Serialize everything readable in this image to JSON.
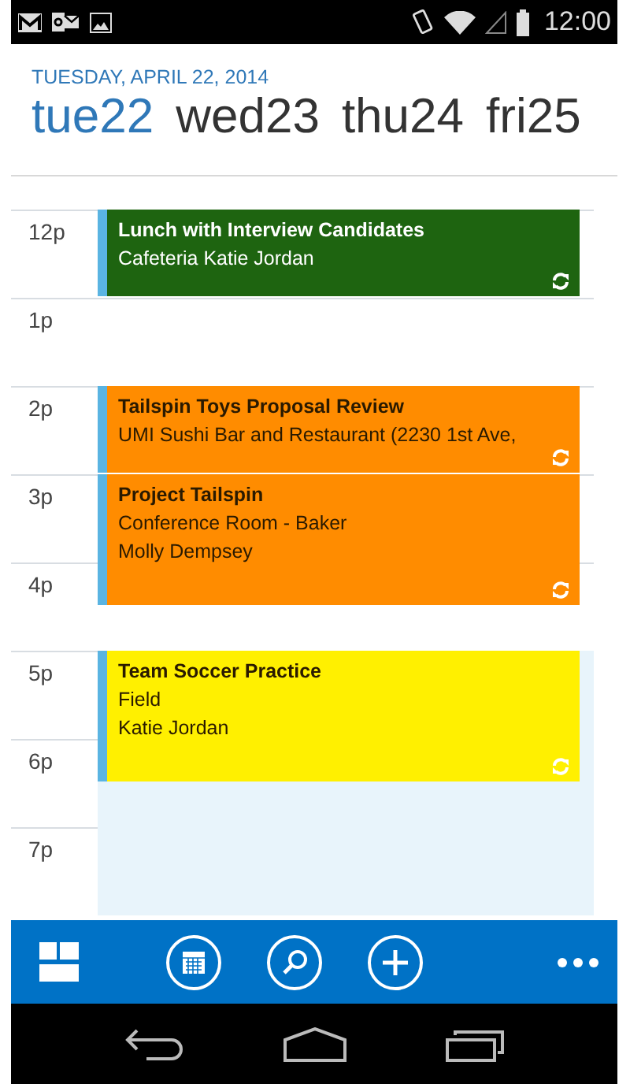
{
  "status_bar": {
    "time": "12:00"
  },
  "header": {
    "date": "TUESDAY, APRIL 22, 2014"
  },
  "days": [
    {
      "label": "tue22",
      "selected": true
    },
    {
      "label": "wed23",
      "selected": false
    },
    {
      "label": "thu24",
      "selected": false
    },
    {
      "label": "fri25",
      "selected": false
    }
  ],
  "hours": [
    {
      "label": "12p",
      "shaded": false,
      "events": [
        {
          "title": "Lunch with Interview Candidates",
          "details": [
            "Cafeteria Katie Jordan"
          ],
          "kind": "hour",
          "color": "#1e6410",
          "recurring": true
        }
      ]
    },
    {
      "label": "1p",
      "shaded": false
    },
    {
      "label": "2p",
      "shaded": false,
      "events": [
        {
          "title": "Tailspin Toys Proposal Review",
          "details": [
            "UMI Sushi Bar and Restaurant (2230 1st Ave,"
          ],
          "kind": "hour",
          "color": "#ff8c00",
          "recurring": true
        }
      ]
    },
    {
      "label": "3p",
      "shaded": false,
      "events": [
        {
          "title": "Project Tailspin",
          "details": [
            "Conference Room - Baker",
            "Molly Dempsey"
          ],
          "kind": "ninety",
          "color": "#ff8c00",
          "recurring": true
        }
      ]
    },
    {
      "label": "4p",
      "shaded": false
    },
    {
      "label": "5p",
      "shaded": true,
      "events": [
        {
          "title": "Team Soccer Practice",
          "details": [
            "Field",
            "Katie Jordan"
          ],
          "kind": "ninety",
          "color": "#fff000",
          "recurring": true
        }
      ]
    },
    {
      "label": "6p",
      "shaded": true
    },
    {
      "label": "7p",
      "shaded": true
    }
  ]
}
